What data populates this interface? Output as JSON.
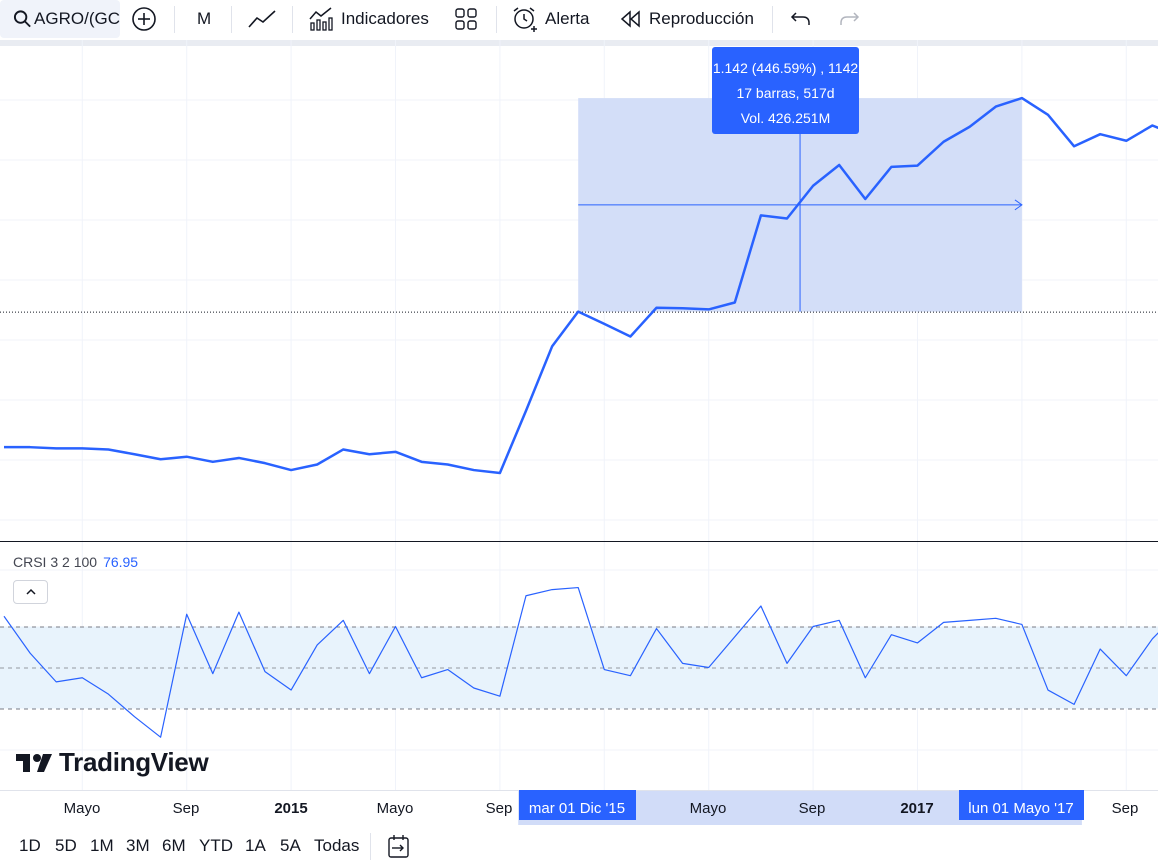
{
  "toolbar": {
    "symbol": "AGRO/(GC",
    "interval": "M",
    "indicators_label": "Indicadores",
    "alert_label": "Alerta",
    "replay_label": "Reproducción"
  },
  "measure_tooltip": {
    "line1": "1.142 (446.59%) , 1142",
    "line2": "17 barras, 517d",
    "line3": "Vol. 426.251M"
  },
  "indicator": {
    "name": "CRSI 3 2 100",
    "value": "76.95"
  },
  "time_axis": {
    "labels": [
      "Mayo",
      "Sep",
      "2015",
      "Mayo",
      "Sep",
      "Mayo",
      "Sep",
      "2017",
      "Sep"
    ],
    "range_start_label": "mar 01 Dic '15",
    "range_end_label": "lun 01 Mayo '17"
  },
  "range_buttons": [
    "1D",
    "5D",
    "1M",
    "3M",
    "6M",
    "YTD",
    "1A",
    "5A",
    "Todas"
  ],
  "logo": {
    "text": "TradingView"
  },
  "colors": {
    "accent": "#2962ff",
    "line": "#2962ff",
    "selection": "#d1dcf8",
    "rsi_band": "#e8f3fc"
  },
  "chart_data": {
    "type": "line",
    "price_series": {
      "name": "",
      "relative_values": [
        0.86,
        0.86,
        0.85,
        0.85,
        0.84,
        0.8,
        0.76,
        0.78,
        0.74,
        0.77,
        0.73,
        0.68,
        0.72,
        0.84,
        0.8,
        0.82,
        0.74,
        0.72,
        0.68,
        0.66,
        1.25,
        2.42,
        3.46,
        3.05,
        2.68,
        3.6,
        3.58,
        3.54,
        3.8,
        9.3,
        9.0,
        12.6,
        15.6,
        11.0,
        15.3,
        15.5,
        19.8,
        23.1,
        28.4,
        31.0,
        26.1,
        18.9,
        21.4,
        20.0,
        23.4,
        21.0
      ],
      "measured_change": "446.59%",
      "measured_bars": 17
    },
    "crsi_series": {
      "name": "CRSI 3 2 100",
      "values": [
        75,
        57,
        43,
        45,
        37,
        26,
        16,
        76,
        47,
        77,
        48,
        39,
        61,
        73,
        47,
        70,
        45,
        49,
        40,
        36,
        85,
        88,
        89,
        49,
        46,
        69,
        52,
        50,
        65,
        80,
        52,
        70,
        73,
        45,
        66,
        62,
        72,
        73,
        74,
        71,
        39,
        32,
        59,
        46,
        64,
        76.95
      ],
      "bands": [
        70,
        50,
        30
      ],
      "ylim": [
        0,
        100
      ]
    }
  }
}
